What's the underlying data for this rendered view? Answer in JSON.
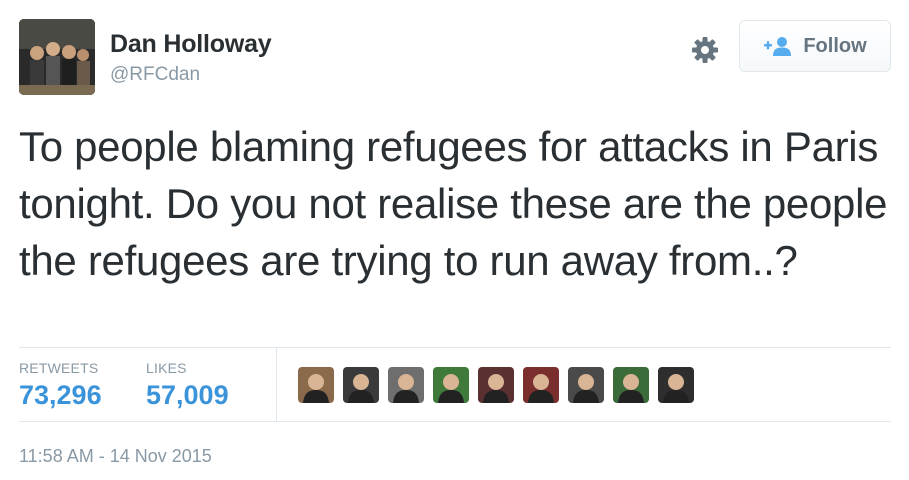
{
  "author": {
    "name": "Dan Holloway",
    "handle": "@RFCdan",
    "avatar_icon": "group-photo-avatar"
  },
  "actions": {
    "settings_icon": "gear-icon",
    "follow_label": "Follow",
    "follow_icon": "add-user-icon"
  },
  "tweet": {
    "text": "To people blaming refugees for attacks in Paris tonight. Do you not realise these are the people the refugees are trying to run away from..?"
  },
  "stats": {
    "retweets_label": "RETWEETS",
    "retweets_value": "73,296",
    "likes_label": "LIKES",
    "likes_value": "57,009"
  },
  "likers": [
    {
      "icon": "user-avatar-1",
      "color": "#8a6a4a"
    },
    {
      "icon": "user-avatar-2",
      "color": "#3a3a3a"
    },
    {
      "icon": "user-avatar-3",
      "color": "#6e6e6e"
    },
    {
      "icon": "user-avatar-4",
      "color": "#3f7a3a"
    },
    {
      "icon": "user-avatar-5",
      "color": "#5a3030"
    },
    {
      "icon": "user-avatar-6",
      "color": "#7a2e2e"
    },
    {
      "icon": "user-avatar-7",
      "color": "#4a4a4a"
    },
    {
      "icon": "user-avatar-8",
      "color": "#3c6b3a"
    },
    {
      "icon": "user-avatar-9",
      "color": "#2e2e2e"
    }
  ],
  "timestamp": "11:58 AM - 14 Nov 2015",
  "colors": {
    "text": "#292f33",
    "muted": "#8899a6",
    "link_blue": "#3b94d9",
    "border": "#e1e8ed"
  }
}
